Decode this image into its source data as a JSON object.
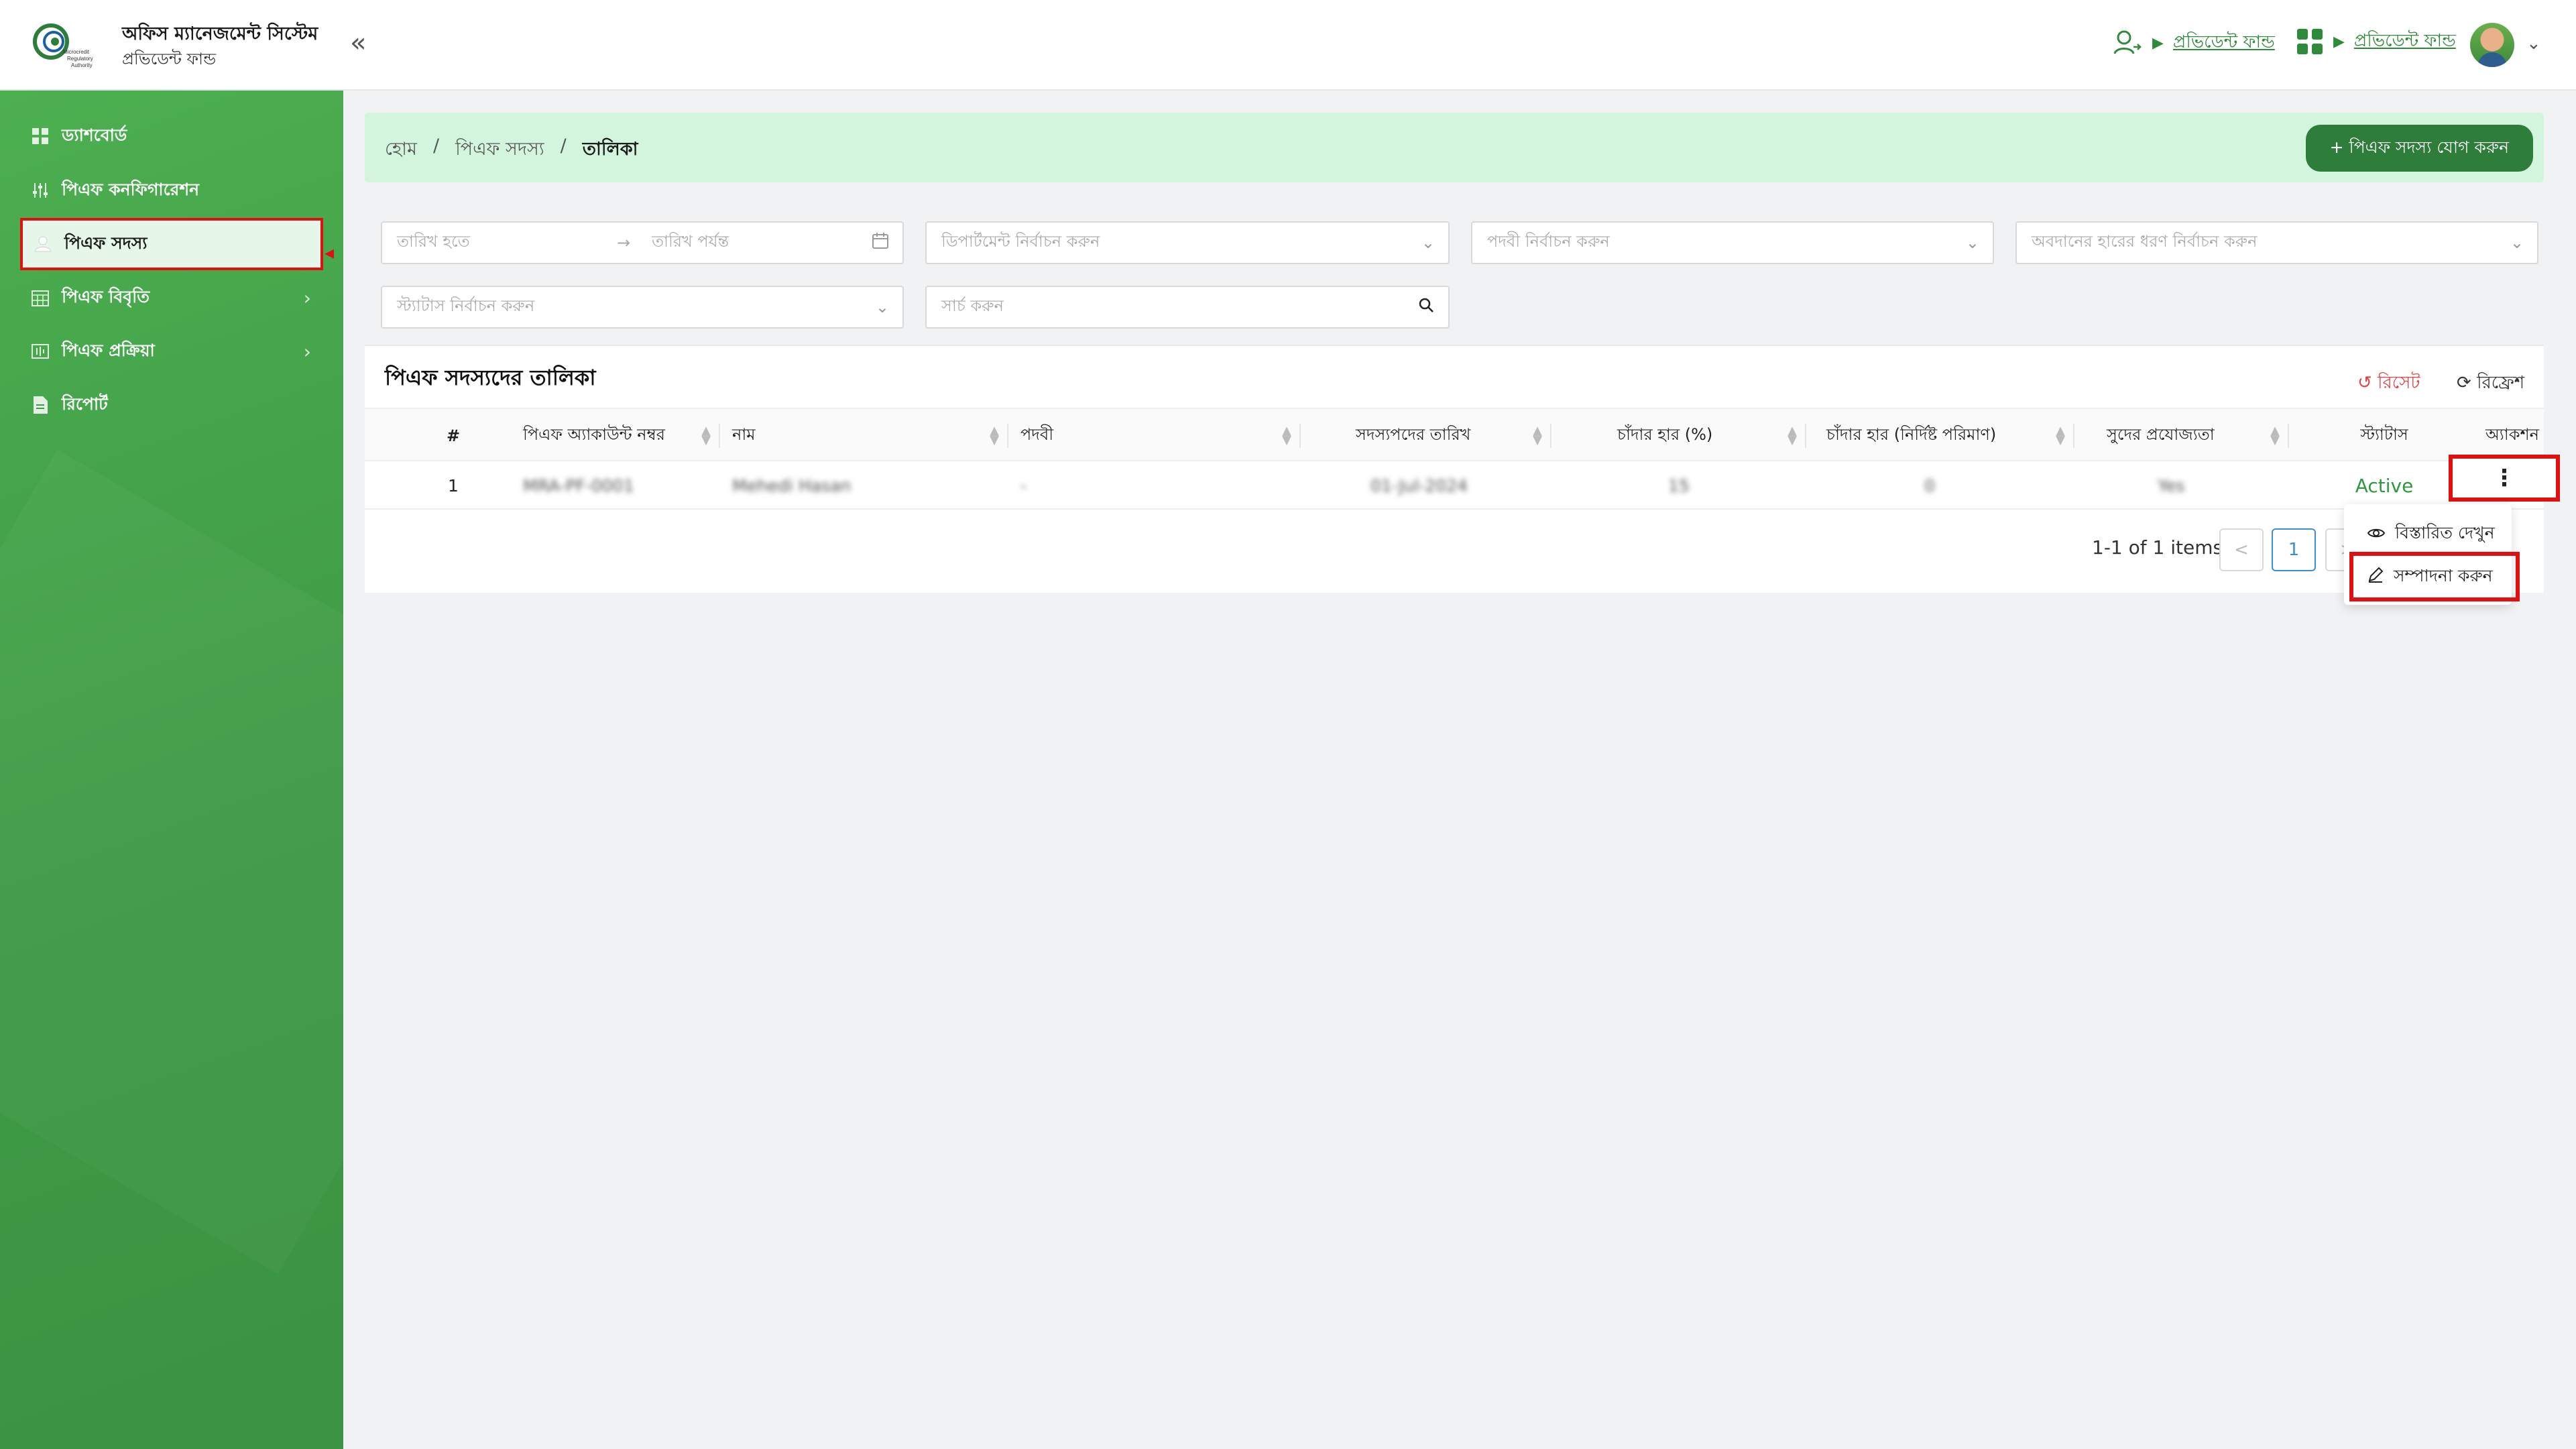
{
  "header": {
    "app_title": "অফিস ম্যানেজমেন্ট সিস্টেম",
    "app_subtitle": "প্রভিডেন্ট ফান্ড",
    "logo_text": "Microcredit Regulatory Authority",
    "nav1_label": "প্রভিডেন্ট ফান্ড",
    "nav2_label": "প্রভিডেন্ট ফান্ড"
  },
  "sidebar": {
    "items": [
      {
        "label": "ড্যাশবোর্ড"
      },
      {
        "label": "পিএফ কনফিগারেশন"
      },
      {
        "label": "পিএফ সদস্য"
      },
      {
        "label": "পিএফ বিবৃতি"
      },
      {
        "label": "পিএফ প্রক্রিয়া"
      },
      {
        "label": "রিপোর্ট"
      }
    ]
  },
  "breadcrumb": {
    "home": "হোম",
    "members": "পিএফ সদস্য",
    "current": "তালিকা",
    "separator": "/"
  },
  "add_button": "+ পিএফ সদস্য যোগ করুন",
  "filters": {
    "date_from": "তারিখ হতে",
    "date_to": "তারিখ পর্যন্ত",
    "department": "ডিপার্টমেন্ট নির্বাচন করুন",
    "designation": "পদবী নির্বাচন করুন",
    "contribution_type": "অবদানের হারের ধরণ নির্বাচন করুন",
    "status": "স্ট্যাটাস নির্বাচন করুন",
    "search": "সার্চ করুন"
  },
  "table": {
    "title": "পিএফ সদস্যদের তালিকা",
    "reset": "রিসেট",
    "refresh": "রিফ্রেশ",
    "columns": [
      "#",
      "পিএফ অ্যাকাউন্ট নম্বর",
      "নাম",
      "পদবী",
      "সদস্যপদের তারিখ",
      "চাঁদার হার (%)",
      "চাঁদার হার (নির্দিষ্ট পরিমাণ)",
      "সুদের প্রযোজ্যতা",
      "স্ট্যাটাস",
      "অ্যাকশন"
    ],
    "rows": [
      {
        "index": "1",
        "account": "MRA-PF-0001",
        "name": "Mehedi Hasan",
        "designation": "-",
        "date": "01-Jul-2024",
        "rate_pct": "15",
        "rate_fixed": "0",
        "interest": "Yes",
        "status": "Active",
        "action": "⋮"
      }
    ]
  },
  "pagination": {
    "info": "1-1 of 1 items",
    "prev": "<",
    "page": "1",
    "next": ">"
  },
  "action_menu": {
    "view": "বিস্তারিত দেখুন",
    "edit": "সম্পাদনা করুন"
  }
}
